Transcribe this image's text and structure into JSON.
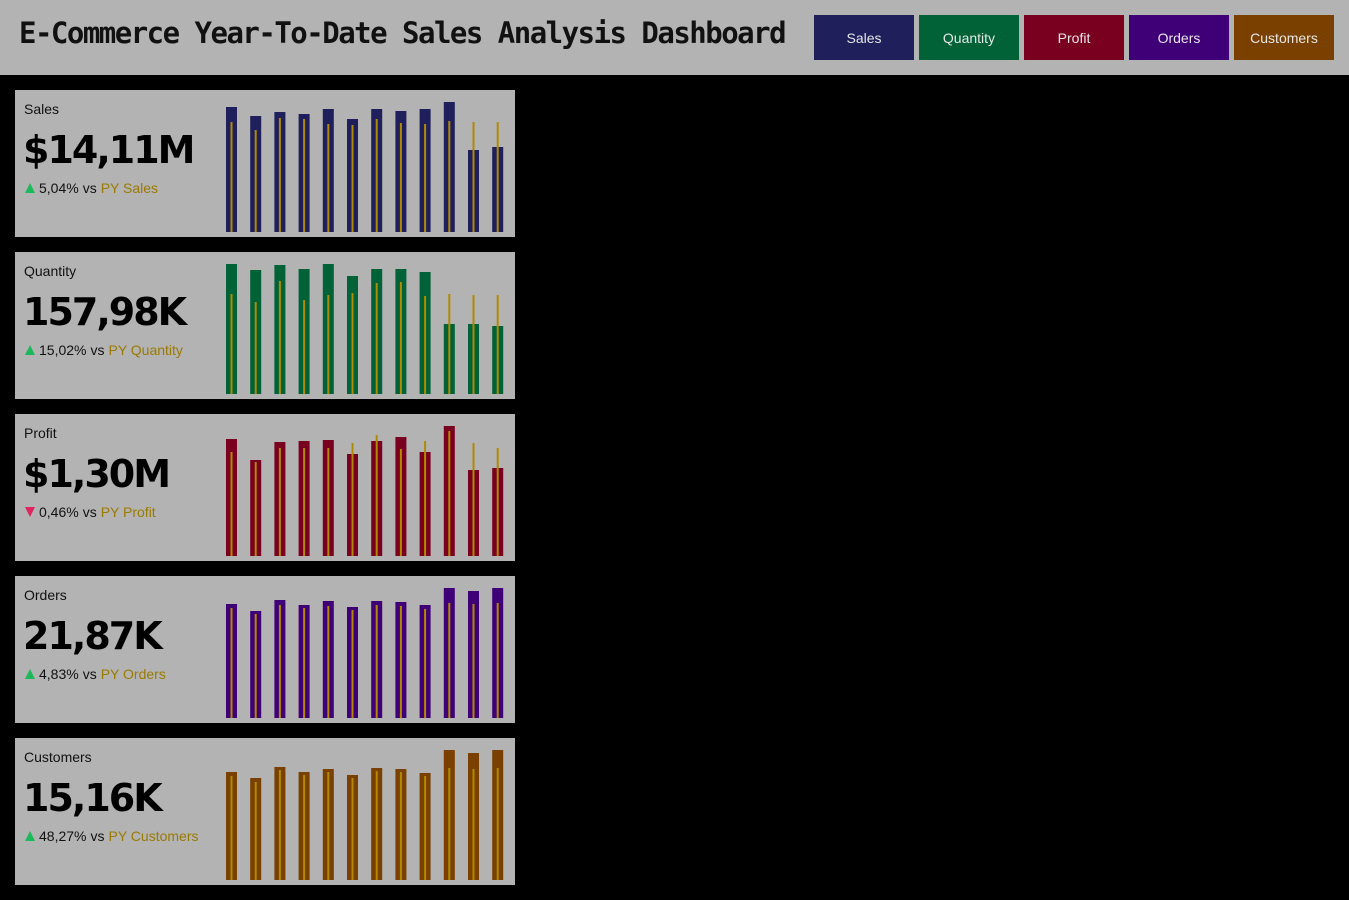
{
  "header": {
    "title": "E-Commerce Year-To-Date Sales Analysis Dashboard",
    "nav": [
      {
        "label": "Sales",
        "color": "#1f1f5c"
      },
      {
        "label": "Quantity",
        "color": "#006236"
      },
      {
        "label": "Profit",
        "color": "#7a0020"
      },
      {
        "label": "Orders",
        "color": "#3f0077"
      },
      {
        "label": "Customers",
        "color": "#7a4000"
      }
    ]
  },
  "colors": {
    "background": "#000000",
    "panel": "#b3b3b3",
    "py_marker": "#b08a00",
    "up_arrow": "#1db85a",
    "down_arrow": "#e0245e"
  },
  "cards": [
    {
      "label": "Sales",
      "value": "$14,11M",
      "delta": "5,04%",
      "direction": "up",
      "vs": "vs",
      "py_label": "PY Sales",
      "color": "#1f1f5c"
    },
    {
      "label": "Quantity",
      "value": "157,98K",
      "delta": "15,02%",
      "direction": "up",
      "vs": "vs",
      "py_label": "PY Quantity",
      "color": "#006236"
    },
    {
      "label": "Profit",
      "value": "$1,30M",
      "delta": "0,46%",
      "direction": "down",
      "vs": "vs",
      "py_label": "PY Profit",
      "color": "#7a0020"
    },
    {
      "label": "Orders",
      "value": "21,87K",
      "delta": "4,83%",
      "direction": "up",
      "vs": "vs",
      "py_label": "PY Orders",
      "color": "#3f0077"
    },
    {
      "label": "Customers",
      "value": "15,16K",
      "delta": "48,27%",
      "direction": "up",
      "vs": "vs",
      "py_label": "PY Customers",
      "color": "#7a4000"
    }
  ],
  "chart_data": [
    {
      "type": "bar",
      "title": "",
      "series": [
        {
          "name": "",
          "values": [
            125,
            116,
            120,
            118,
            123,
            113,
            123,
            121,
            123,
            130,
            82,
            85
          ]
        },
        {
          "name": "",
          "values": [
            110,
            102,
            114,
            113,
            108,
            107,
            113,
            109,
            108,
            111,
            110,
            110
          ]
        }
      ],
      "ylim": [
        0,
        130
      ]
    },
    {
      "type": "bar",
      "title": "",
      "series": [
        {
          "name": "",
          "values": [
            130,
            124,
            129,
            125,
            130,
            118,
            125,
            125,
            122,
            70,
            70,
            68
          ]
        },
        {
          "name": "",
          "values": [
            100,
            92,
            113,
            94,
            99,
            101,
            111,
            112,
            98,
            100,
            99,
            99
          ]
        }
      ],
      "ylim": [
        0,
        130
      ]
    },
    {
      "type": "bar",
      "title": "",
      "series": [
        {
          "name": "",
          "values": [
            117,
            96,
            114,
            115,
            116,
            102,
            115,
            119,
            104,
            130,
            86,
            88
          ]
        },
        {
          "name": "",
          "values": [
            104,
            94,
            108,
            108,
            108,
            113,
            121,
            107,
            115,
            125,
            113,
            108
          ]
        }
      ],
      "ylim": [
        0,
        130
      ]
    },
    {
      "type": "bar",
      "title": "",
      "series": [
        {
          "name": "",
          "values": [
            114,
            107,
            118,
            113,
            117,
            111,
            117,
            116,
            113,
            130,
            127,
            130
          ]
        },
        {
          "name": "",
          "values": [
            110,
            104,
            113,
            110,
            112,
            108,
            113,
            112,
            109,
            115,
            114,
            115
          ]
        }
      ],
      "ylim": [
        0,
        130
      ]
    },
    {
      "type": "bar",
      "title": "",
      "series": [
        {
          "name": "",
          "values": [
            108,
            102,
            113,
            108,
            111,
            105,
            112,
            111,
            107,
            130,
            127,
            130
          ]
        },
        {
          "name": "",
          "values": [
            104,
            98,
            110,
            105,
            108,
            102,
            109,
            108,
            104,
            112,
            111,
            112
          ]
        }
      ],
      "ylim": [
        0,
        130
      ]
    }
  ]
}
